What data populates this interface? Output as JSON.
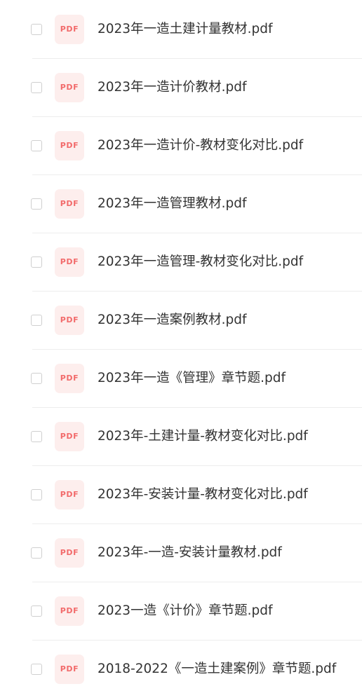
{
  "colors": {
    "pdf_badge_background": "#fdeeed",
    "pdf_badge_text": "#f26b6b",
    "file_name_text": "#333333",
    "divider": "#ededed",
    "checkbox_border": "#cfcfcf"
  },
  "icons": {
    "file_type": "pdf-icon",
    "select": "checkbox-icon"
  },
  "files": [
    {
      "badge": "PDF",
      "name": "2023年一造土建计量教材.pdf",
      "selected": false
    },
    {
      "badge": "PDF",
      "name": "2023年一造计价教材.pdf",
      "selected": false
    },
    {
      "badge": "PDF",
      "name": "2023年一造计价-教材变化对比.pdf",
      "selected": false
    },
    {
      "badge": "PDF",
      "name": "2023年一造管理教材.pdf",
      "selected": false
    },
    {
      "badge": "PDF",
      "name": "2023年一造管理-教材变化对比.pdf",
      "selected": false
    },
    {
      "badge": "PDF",
      "name": "2023年一造案例教材.pdf",
      "selected": false
    },
    {
      "badge": "PDF",
      "name": "2023年一造《管理》章节题.pdf",
      "selected": false
    },
    {
      "badge": "PDF",
      "name": "2023年-土建计量-教材变化对比.pdf",
      "selected": false
    },
    {
      "badge": "PDF",
      "name": "2023年-安装计量-教材变化对比.pdf",
      "selected": false
    },
    {
      "badge": "PDF",
      "name": "2023年-一造-安装计量教材.pdf",
      "selected": false
    },
    {
      "badge": "PDF",
      "name": "2023一造《计价》章节题.pdf",
      "selected": false
    },
    {
      "badge": "PDF",
      "name": "2018-2022《一造土建案例》章节题.pdf",
      "selected": false
    }
  ]
}
